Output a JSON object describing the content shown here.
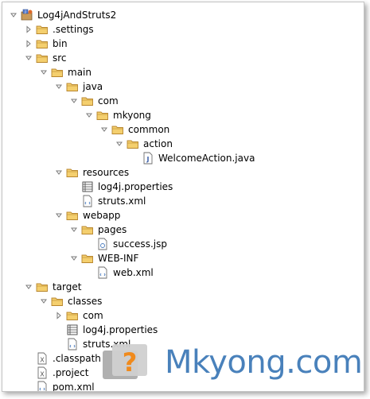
{
  "tree": [
    {
      "label": "Log4jAndStruts2",
      "icon": "project-icon",
      "toggle": "expanded"
    },
    {
      "label": ".settings",
      "icon": "folder-icon",
      "toggle": "collapsed"
    },
    {
      "label": "bin",
      "icon": "folder-icon",
      "toggle": "collapsed"
    },
    {
      "label": "src",
      "icon": "folder-icon",
      "toggle": "expanded"
    },
    {
      "label": "main",
      "icon": "folder-icon",
      "toggle": "expanded"
    },
    {
      "label": "java",
      "icon": "folder-icon",
      "toggle": "expanded"
    },
    {
      "label": "com",
      "icon": "folder-icon",
      "toggle": "expanded"
    },
    {
      "label": "mkyong",
      "icon": "folder-icon",
      "toggle": "expanded"
    },
    {
      "label": "common",
      "icon": "folder-icon",
      "toggle": "expanded"
    },
    {
      "label": "action",
      "icon": "folder-icon",
      "toggle": "expanded"
    },
    {
      "label": "WelcomeAction.java",
      "icon": "java-file-icon",
      "toggle": "none"
    },
    {
      "label": "resources",
      "icon": "folder-icon",
      "toggle": "expanded"
    },
    {
      "label": "log4j.properties",
      "icon": "properties-file-icon",
      "toggle": "none"
    },
    {
      "label": "struts.xml",
      "icon": "xml-file-icon",
      "toggle": "none"
    },
    {
      "label": "webapp",
      "icon": "folder-icon",
      "toggle": "expanded"
    },
    {
      "label": "pages",
      "icon": "folder-icon",
      "toggle": "expanded"
    },
    {
      "label": "success.jsp",
      "icon": "jsp-file-icon",
      "toggle": "none"
    },
    {
      "label": "WEB-INF",
      "icon": "folder-icon",
      "toggle": "expanded"
    },
    {
      "label": "web.xml",
      "icon": "xml-file-icon",
      "toggle": "none"
    },
    {
      "label": "target",
      "icon": "folder-icon",
      "toggle": "expanded"
    },
    {
      "label": "classes",
      "icon": "folder-icon",
      "toggle": "expanded"
    },
    {
      "label": "com",
      "icon": "folder-icon",
      "toggle": "collapsed"
    },
    {
      "label": "log4j.properties",
      "icon": "properties-file-icon",
      "toggle": "none"
    },
    {
      "label": "struts.xml",
      "icon": "xml-file-icon",
      "toggle": "none"
    },
    {
      "label": ".classpath",
      "icon": "x-file-icon",
      "toggle": "none"
    },
    {
      "label": ".project",
      "icon": "x-file-icon",
      "toggle": "none"
    },
    {
      "label": "pom.xml",
      "icon": "xml-file-icon",
      "toggle": "none"
    }
  ],
  "watermark": {
    "text": "Mkyong.com",
    "logo_glyph": "?",
    "logo_icon": "mkyong-logo-icon"
  },
  "colors": {
    "folder_fill": "#f4cf6e",
    "folder_stroke": "#b8862d",
    "toggle_color": "#7a7a7a",
    "watermark_blue": "#3a77b6",
    "logo_gray": "#9a9a9a",
    "logo_orange": "#f08a1c"
  }
}
